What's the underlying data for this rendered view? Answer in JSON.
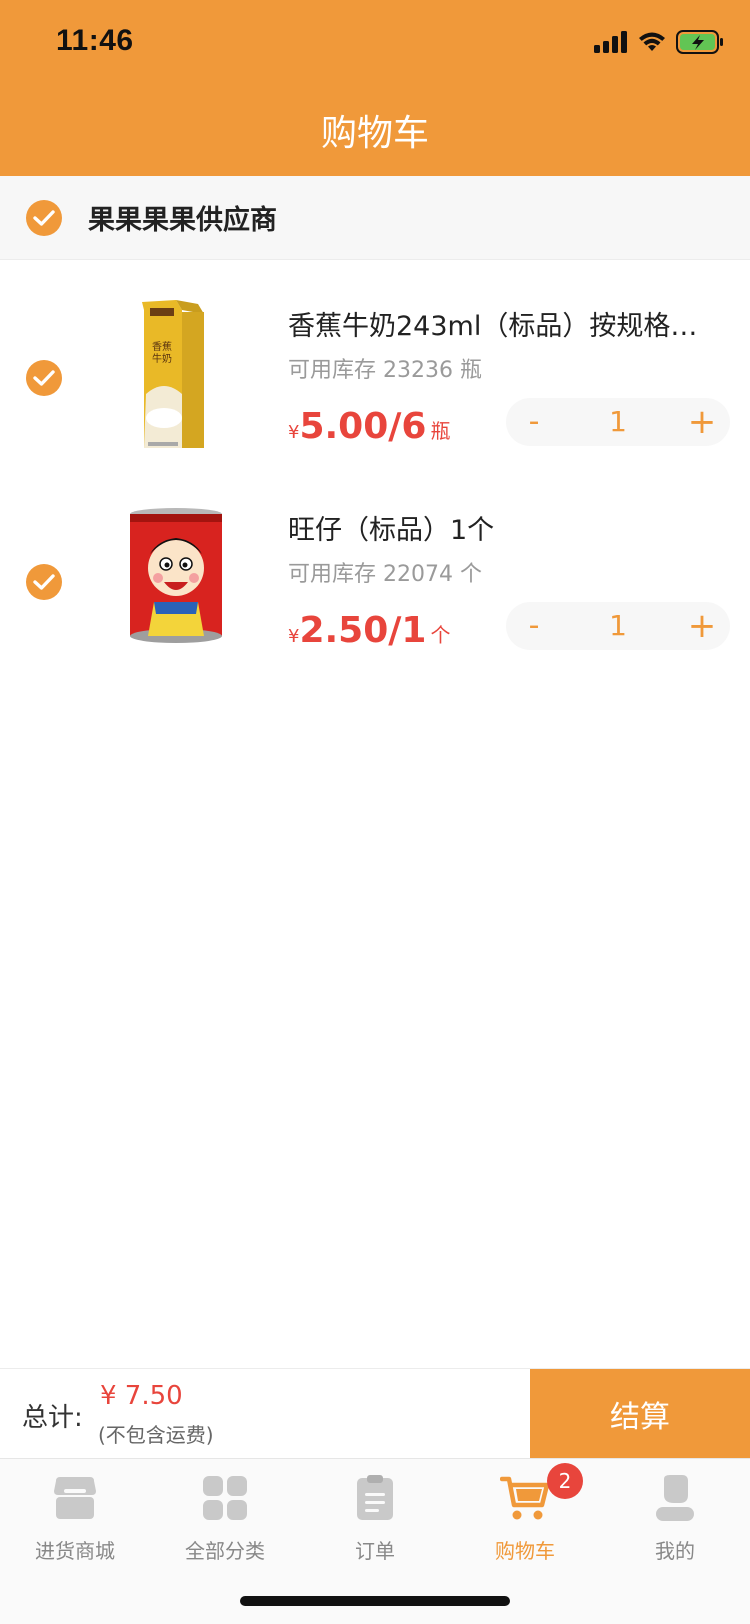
{
  "status_bar": {
    "time": "11:46"
  },
  "header": {
    "title": "购物车"
  },
  "supplier": {
    "name": "果果果果供应商"
  },
  "items": [
    {
      "title": "香蕉牛奶243ml（标品）按规格…",
      "stock": "可用库存 23236 瓶",
      "price_symbol": "¥",
      "price_value": "5.00/6",
      "price_unit": "瓶",
      "quantity": "1",
      "minus_label": "-",
      "plus_label": "+"
    },
    {
      "title": "旺仔（标品）1个",
      "stock": "可用库存 22074 个",
      "price_symbol": "¥",
      "price_value": "2.50/1",
      "price_unit": "个",
      "quantity": "1",
      "minus_label": "-",
      "plus_label": "+"
    }
  ],
  "total": {
    "label": "总计:",
    "amount": "¥ 7.50",
    "note": "(不包含运费)",
    "checkout_label": "结算"
  },
  "tabbar": {
    "tabs": [
      {
        "label": "进货商城",
        "icon": "store-icon"
      },
      {
        "label": "全部分类",
        "icon": "grid-icon"
      },
      {
        "label": "订单",
        "icon": "clipboard-icon"
      },
      {
        "label": "购物车",
        "icon": "cart-icon",
        "badge": "2"
      },
      {
        "label": "我的",
        "icon": "user-icon"
      }
    ]
  },
  "colors": {
    "accent": "#F0993A",
    "price": "#E8453C",
    "badge": "#E8453C"
  }
}
